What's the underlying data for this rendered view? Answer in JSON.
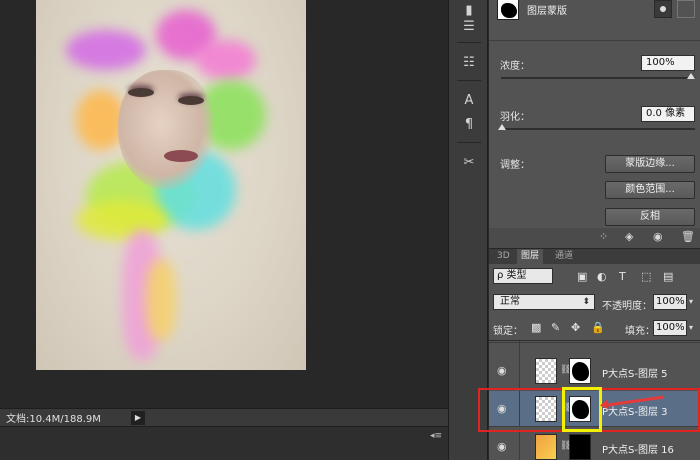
{
  "status": {
    "doc_info": "文档:10.4M/188.9M"
  },
  "properties": {
    "title": "图层蒙版",
    "density_label": "浓度：",
    "density_value": "100%",
    "feather_label": "羽化：",
    "feather_value": "0.0 像素",
    "adjust_label": "调整：",
    "btn_mask_edge": "蒙版边缘...",
    "btn_color_range": "颜色范围...",
    "btn_invert": "反相"
  },
  "layers_panel": {
    "tabs": [
      "3D",
      "图层",
      "通道"
    ],
    "filter_kind": "ρ 类型",
    "blend_mode": "正常",
    "opacity_label": "不透明度：",
    "opacity_value": "100%",
    "lock_label": "锁定：",
    "fill_label": "填充：",
    "fill_value": "100%",
    "layers": [
      {
        "name": "P大点S-图层 5",
        "selected": false
      },
      {
        "name": "P大点S-图层 3",
        "selected": true
      },
      {
        "name": "P大点S-图层 16",
        "selected": false
      }
    ]
  }
}
